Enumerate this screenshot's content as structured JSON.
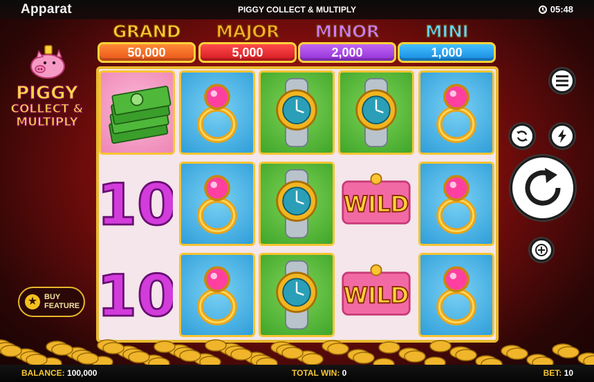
{
  "top_bar": {
    "brand": "Apparat",
    "game_title": "PIGGY COLLECT & MULTIPLY",
    "clock_time": "05:48"
  },
  "jackpots": [
    {
      "name": "GRAND",
      "value": "50,000",
      "name_color": "#ffcc33",
      "box_color": "#f26a1f"
    },
    {
      "name": "MAJOR",
      "value": "5,000",
      "name_color": "#ffb12a",
      "box_color": "#e8282a"
    },
    {
      "name": "MINOR",
      "value": "2,000",
      "name_color": "#d479ff",
      "box_color": "#a53fe0"
    },
    {
      "name": "MINI",
      "value": "1,000",
      "name_color": "#5fd6ff",
      "box_color": "#1a9ee8"
    }
  ],
  "logo": {
    "line1": "PIGGY",
    "line2": "COLLECT &",
    "line3": "MULTIPLY"
  },
  "reels": {
    "columns": [
      [
        "cash-stack",
        "multiplier-10",
        "multiplier-10"
      ],
      [
        "ring",
        "ring",
        "ring"
      ],
      [
        "watch",
        "watch",
        "watch"
      ],
      [
        "watch",
        "wild",
        "wild"
      ],
      [
        "ring",
        "ring",
        "ring"
      ]
    ],
    "multiplier_text": "10",
    "wild_text": "WILD"
  },
  "buy_feature": {
    "line1": "BUY",
    "line2": "FEATURE"
  },
  "controls": [
    "menu-icon",
    "autoplay-icon",
    "turbo-icon",
    "spin-icon",
    "bet-icon"
  ],
  "status": {
    "balance_label": "BALANCE:",
    "balance_value": "100,000",
    "total_win_label": "TOTAL WIN:",
    "total_win_value": "0",
    "bet_label": "BET:",
    "bet_value": "10"
  },
  "colors": {
    "accent_gold": "#f5c632",
    "frame_gold": "#e9b930",
    "ring_gem": "#ff3fa0",
    "wild_pink": "#f26aa4"
  }
}
